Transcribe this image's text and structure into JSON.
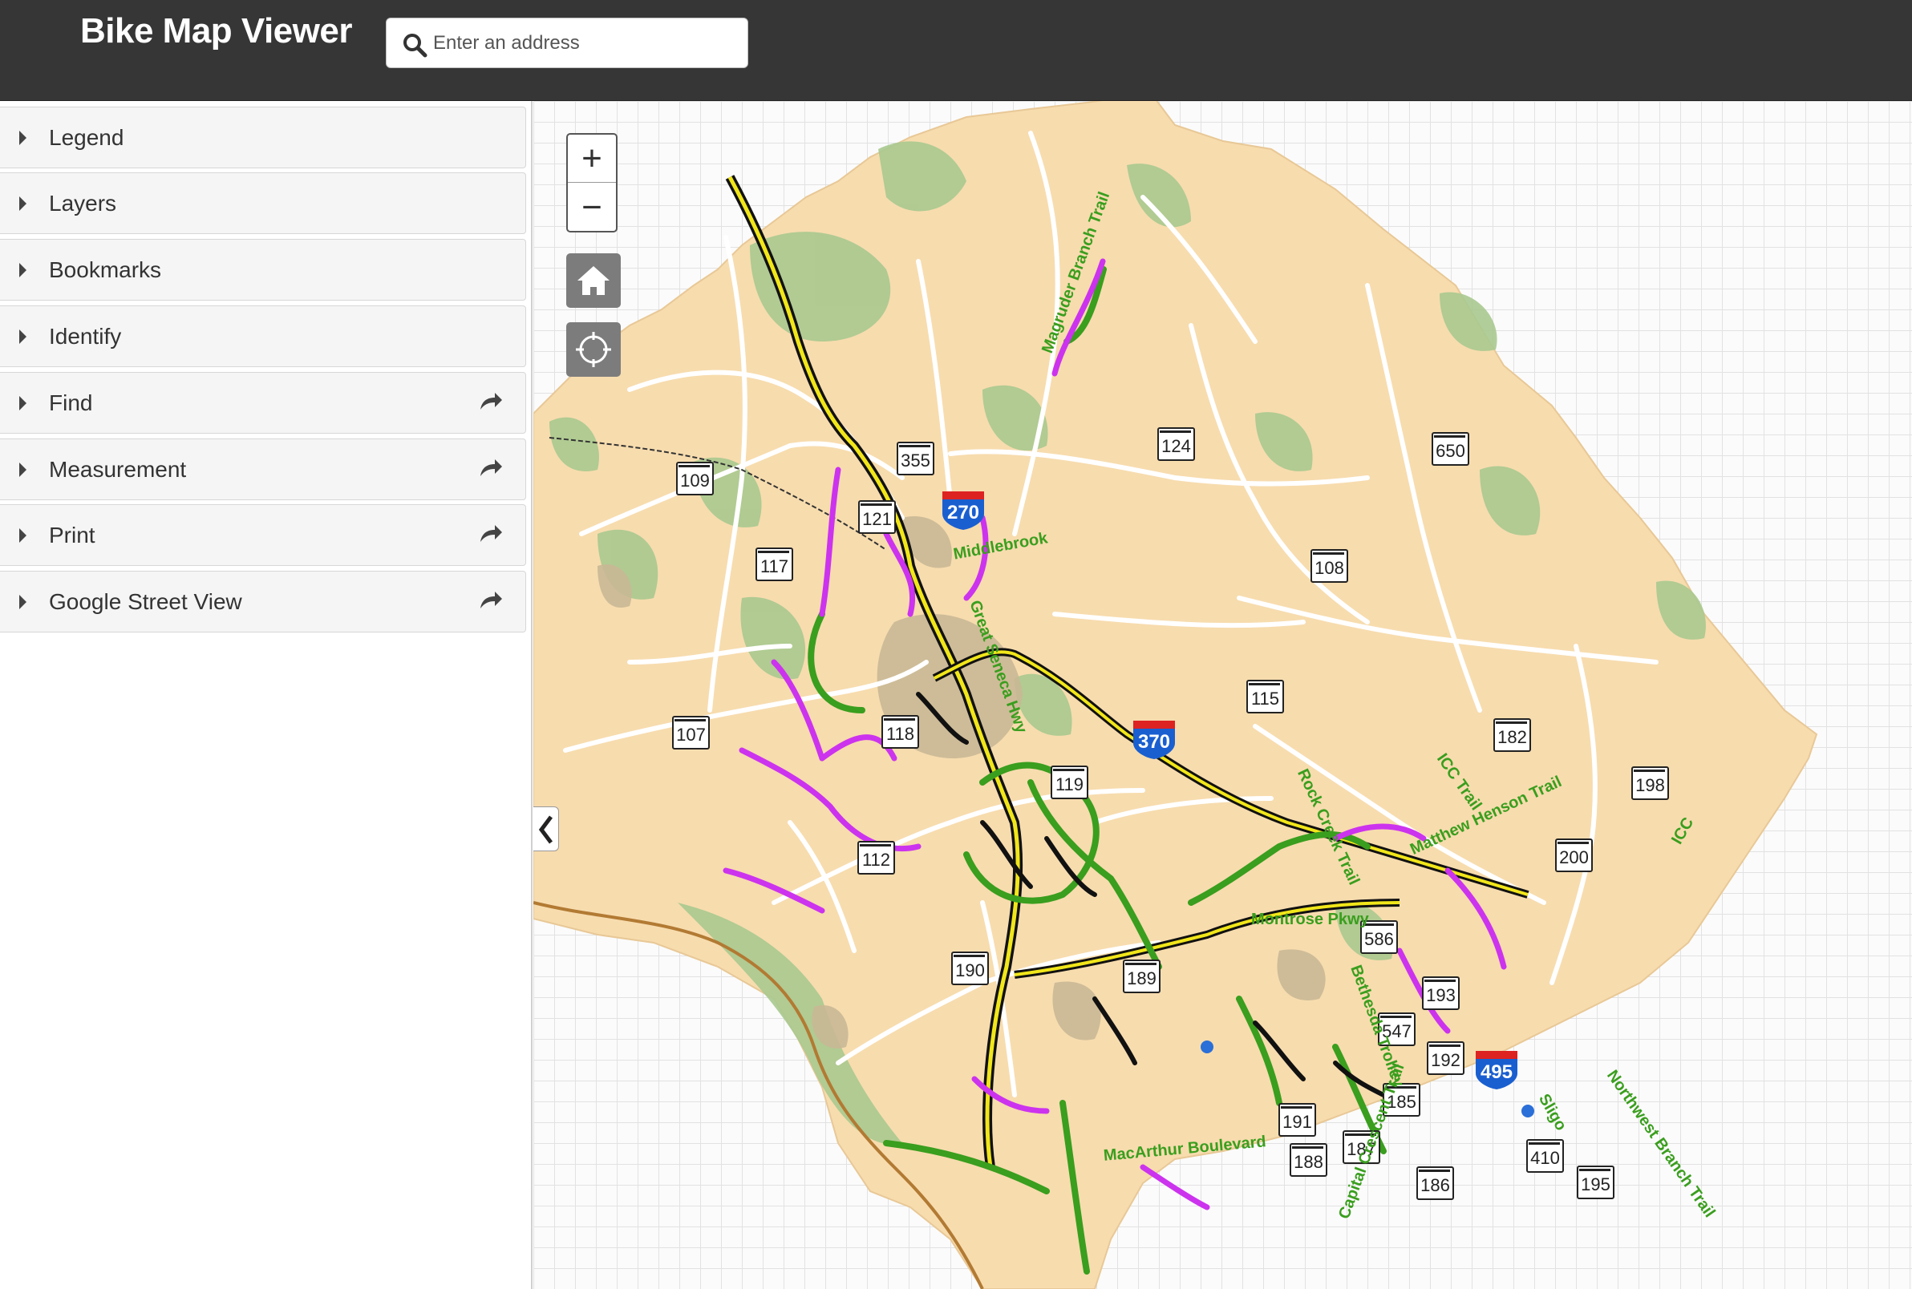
{
  "header": {
    "title": "Bike Map Viewer",
    "search_placeholder": "Enter an address"
  },
  "sidebar": {
    "panels": [
      {
        "label": "Legend",
        "has_share": false
      },
      {
        "label": "Layers",
        "has_share": false
      },
      {
        "label": "Bookmarks",
        "has_share": false
      },
      {
        "label": "Identify",
        "has_share": false
      },
      {
        "label": "Find",
        "has_share": true
      },
      {
        "label": "Measurement",
        "has_share": true
      },
      {
        "label": "Print",
        "has_share": true
      },
      {
        "label": "Google Street View",
        "has_share": true
      }
    ]
  },
  "map": {
    "controls": {
      "zoom_in": "+",
      "zoom_out": "−",
      "home_icon": "home-icon",
      "locate_icon": "locate-icon",
      "collapse_icon": "chevron-left-icon"
    },
    "route_shields": [
      "109",
      "355",
      "124",
      "650",
      "121",
      "117",
      "108",
      "115",
      "107",
      "118",
      "182",
      "119",
      "198",
      "112",
      "200",
      "586",
      "190",
      "189",
      "193",
      "547",
      "192",
      "191",
      "185",
      "187",
      "188",
      "410",
      "186",
      "195"
    ],
    "interstate_shields": [
      "270",
      "370",
      "495"
    ],
    "trail_labels": [
      "Magruder Branch Trail",
      "Middlebrook",
      "Great Seneca Hwy",
      "ICC Trail",
      "Rock Creek Trail",
      "Matthew Henson Trail",
      "ICC",
      "Montrose Pkwy",
      "Bethesda Trolley",
      "Sligo",
      "Northwest Branch Trail",
      "MacArthur Boulevard",
      "Capital Crescent Trail"
    ],
    "colors": {
      "land": "#f7dcae",
      "parks": "#a9c98f",
      "urban": "#c9b896",
      "roads": "#ffffff",
      "interstate": "#f1e61a",
      "trail_green": "#3a9e1e",
      "bike_lane_purple": "#cc33ee",
      "bike_black": "#111111",
      "river": "#b27a33"
    }
  }
}
